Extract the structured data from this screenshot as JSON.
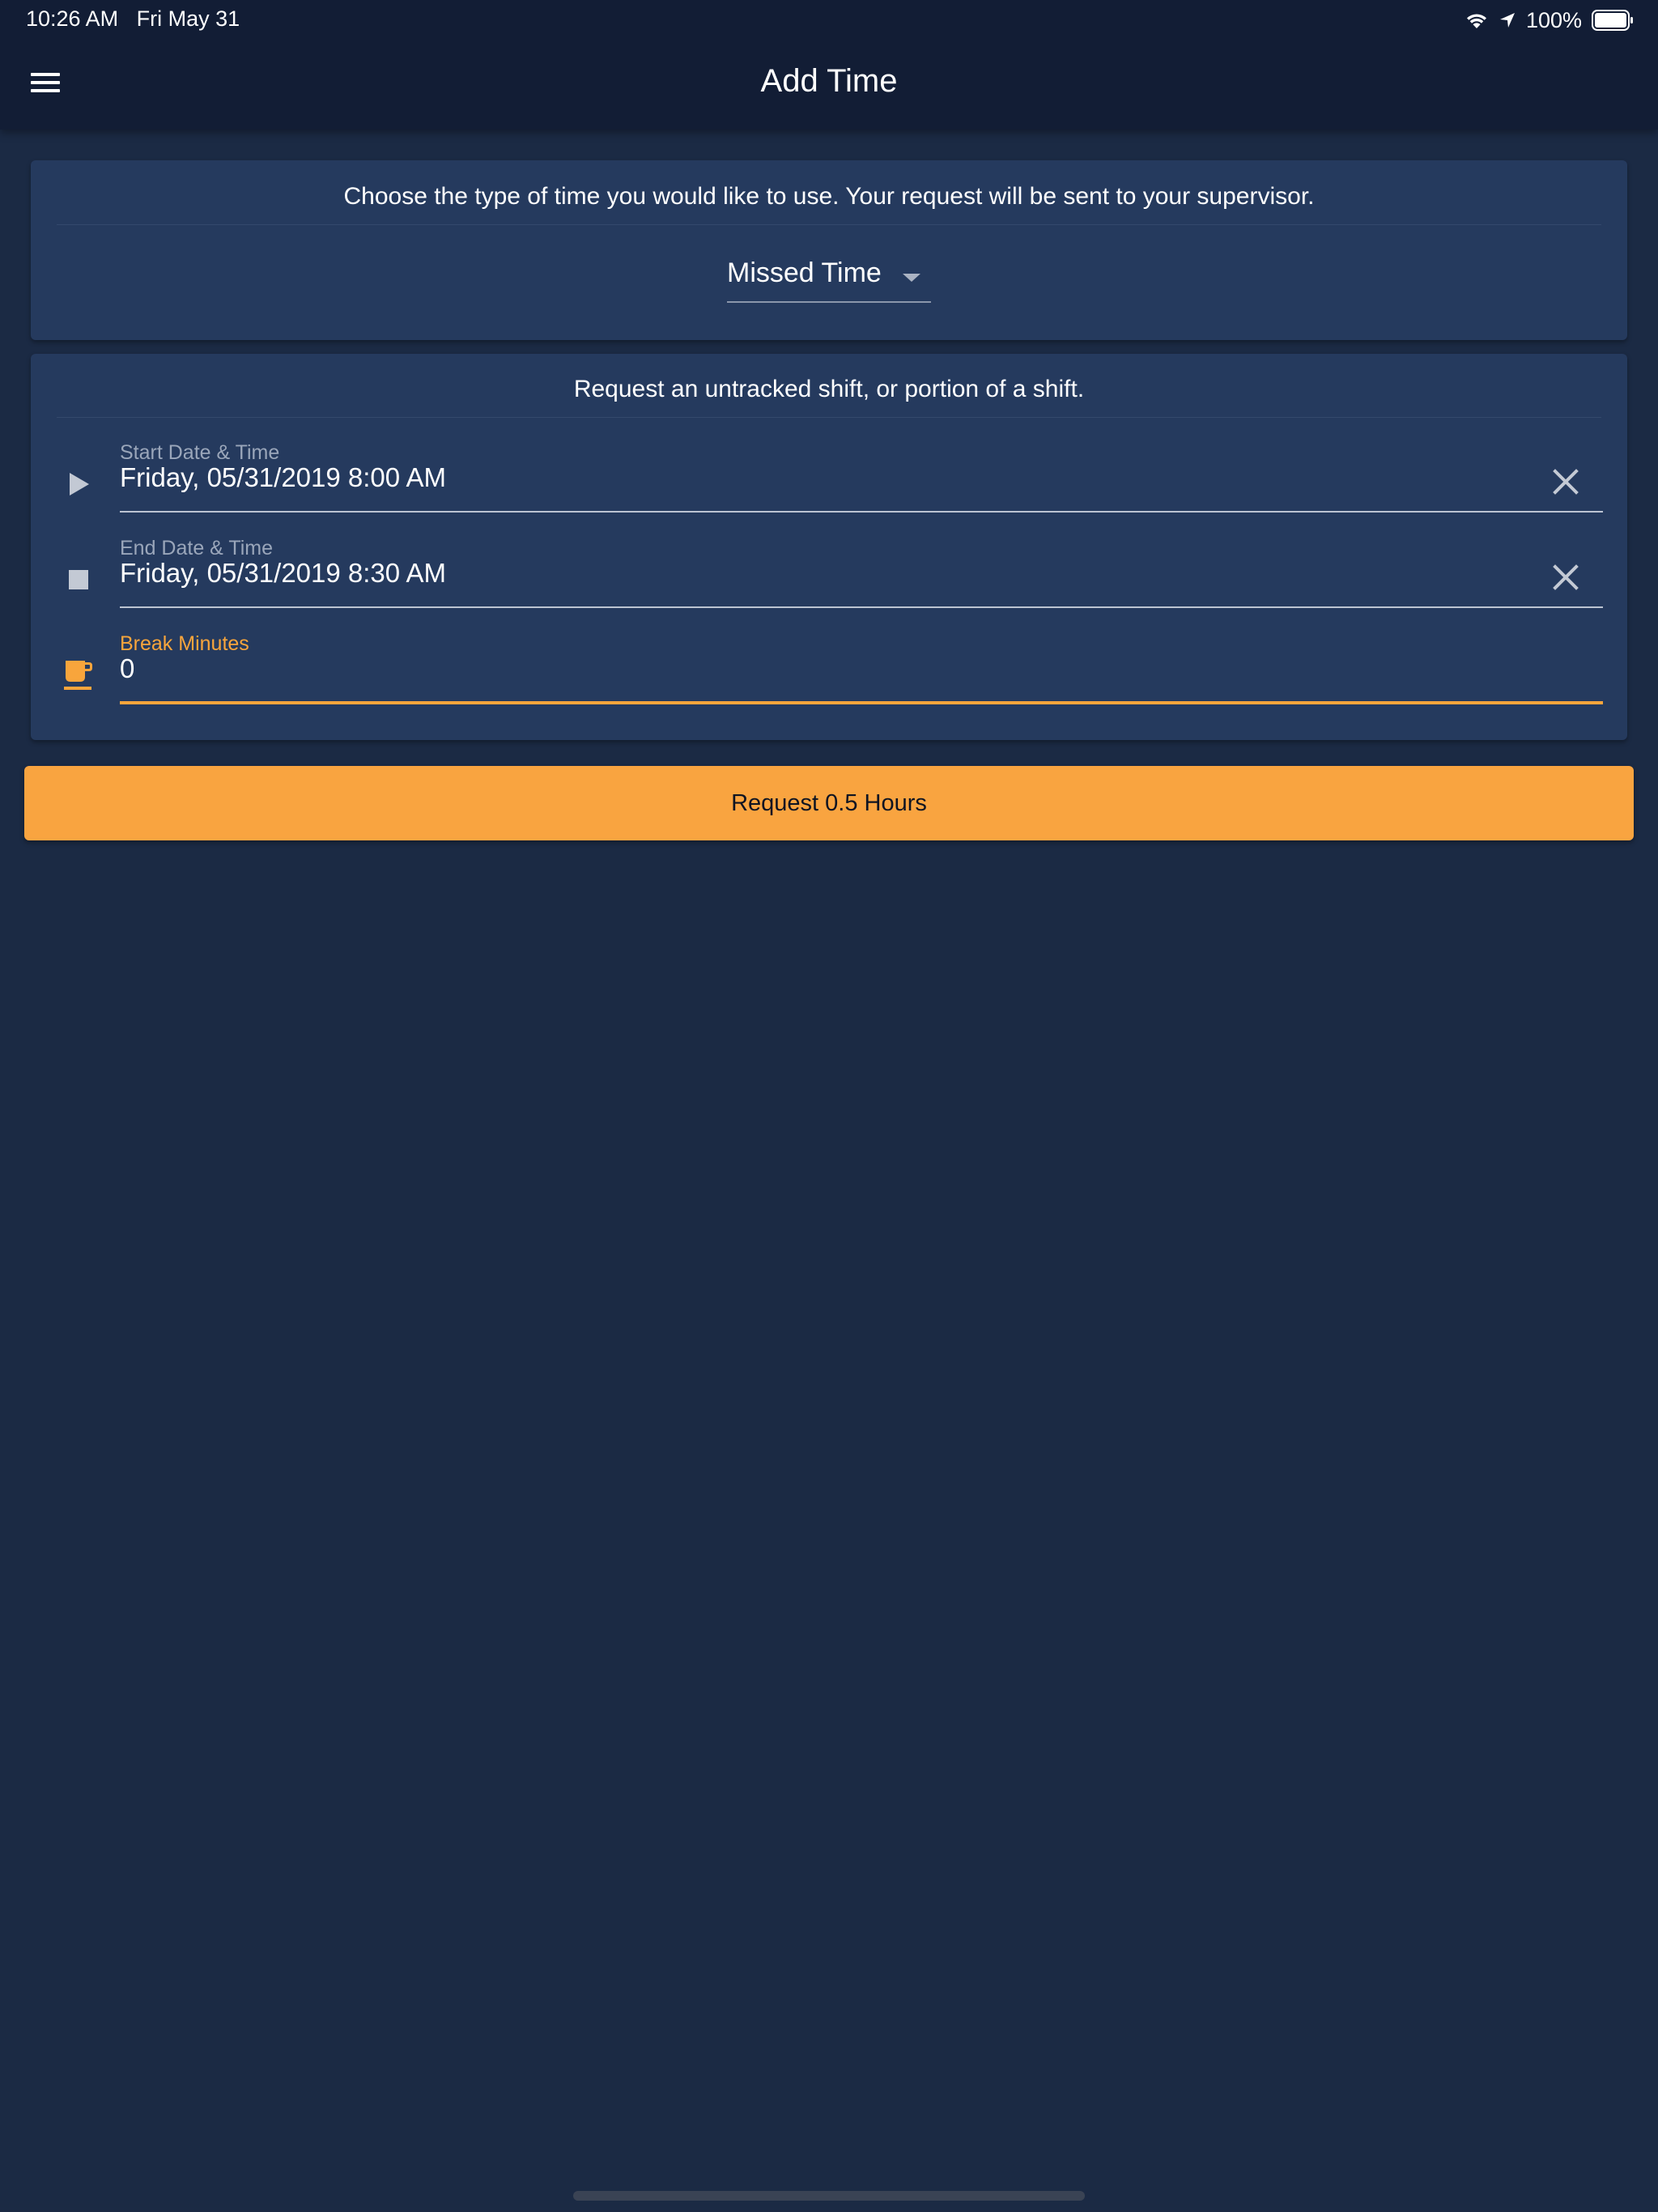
{
  "status_bar": {
    "time": "10:26 AM",
    "date": "Fri May 31",
    "battery_percent": "100%",
    "battery_level": 1.0,
    "icons": [
      "wifi-icon",
      "location-arrow-icon",
      "battery-icon"
    ]
  },
  "nav": {
    "title": "Add Time",
    "menu_icon": "hamburger-menu-icon"
  },
  "type_card": {
    "instruction": "Choose the type of time you would like to use. Your request will be sent to your supervisor.",
    "selected_type": "Missed Time"
  },
  "shift_card": {
    "instruction": "Request an untracked shift, or portion of a shift.",
    "start": {
      "label": "Start Date & Time",
      "value": "Friday, 05/31/2019 8:00 AM",
      "icon": "play-icon"
    },
    "end": {
      "label": "End Date & Time",
      "value": "Friday, 05/31/2019 8:30 AM",
      "icon": "stop-icon"
    },
    "break": {
      "label": "Break Minutes",
      "value": "0",
      "icon": "coffee-cup-icon"
    }
  },
  "request_button": {
    "label": "Request 0.5 Hours"
  },
  "colors": {
    "background": "#1b2a44",
    "header": "#121d35",
    "card": "#253a5e",
    "accent": "#f8a53c"
  }
}
